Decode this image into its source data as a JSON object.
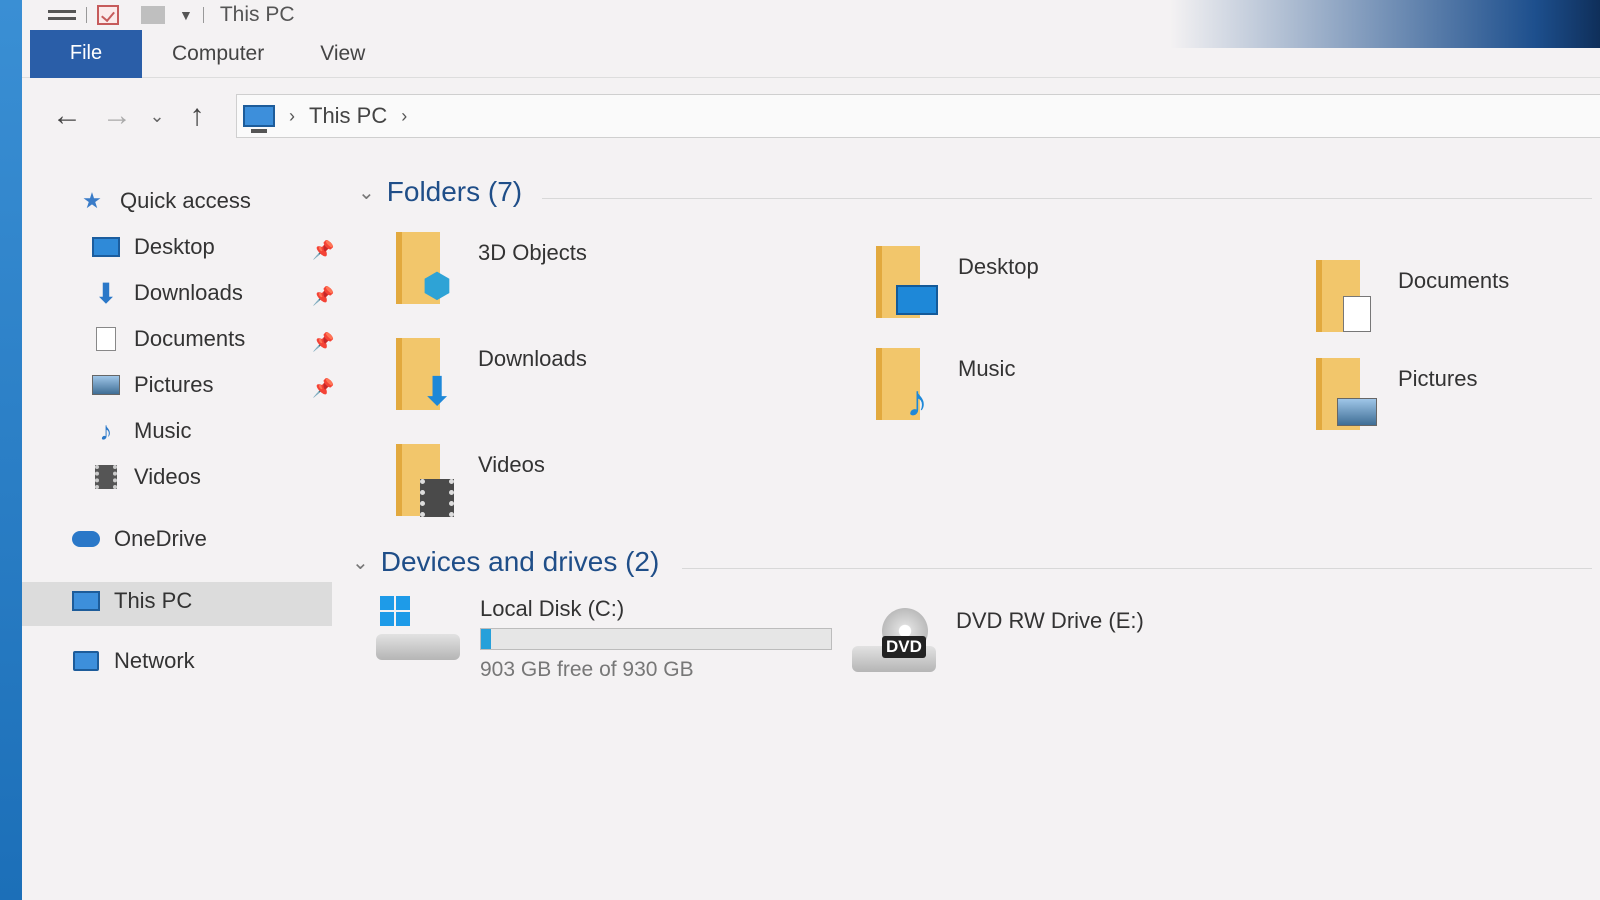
{
  "window": {
    "title": "This PC"
  },
  "ribbon": {
    "tabs": [
      "File",
      "Computer",
      "View"
    ]
  },
  "address": {
    "crumbs": [
      "This PC"
    ]
  },
  "nav": {
    "quick_access": "Quick access",
    "items": [
      {
        "label": "Desktop",
        "pinned": true
      },
      {
        "label": "Downloads",
        "pinned": true
      },
      {
        "label": "Documents",
        "pinned": true
      },
      {
        "label": "Pictures",
        "pinned": true
      },
      {
        "label": "Music",
        "pinned": false
      },
      {
        "label": "Videos",
        "pinned": false
      }
    ],
    "onedrive": "OneDrive",
    "this_pc": "This PC",
    "network": "Network"
  },
  "folders": {
    "header": "Folders (7)",
    "items": [
      "3D Objects",
      "Desktop",
      "Documents",
      "Downloads",
      "Music",
      "Pictures",
      "Videos"
    ]
  },
  "drives": {
    "header": "Devices and drives (2)",
    "local": {
      "name": "Local Disk (C:)",
      "free_text": "903 GB free of 930 GB",
      "used_fraction": 0.029
    },
    "dvd": {
      "name": "DVD RW Drive (E:)",
      "badge": "DVD"
    }
  },
  "colors": {
    "accent": "#2a5ea8",
    "header_blue": "#1f4e88",
    "drive_bar": "#26a0da",
    "folder": "#f2c66b"
  }
}
